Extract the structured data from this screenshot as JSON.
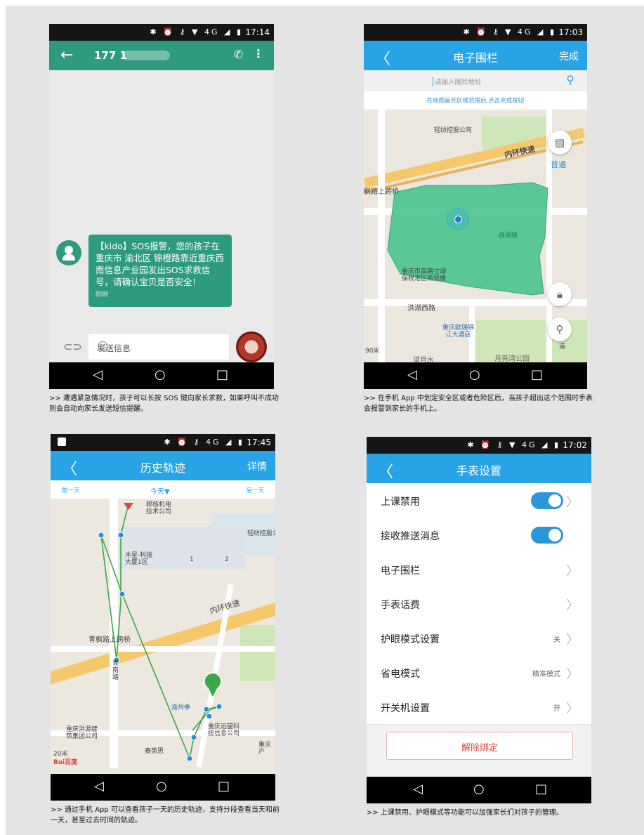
{
  "panel1": {
    "status_time": "17:14",
    "status_icons": "✱ ⏰ ⚷ ▼ 4G ◢ ▮",
    "contact": "177 1",
    "phone_icon": "phone-icon",
    "menu_icon": "more-vert-icon",
    "message": "【kido】SOS报警，您的孩子在 重庆市 渝北区 锦橙路靠近重庆西南信息产业园发出SOS求救信号，请确认宝贝是否安全！",
    "message_time": "刚刚",
    "compose_placeholder": "发送信息",
    "caption": ">> 遭遇紧急情况时，孩子可以长按 SOS 键向家长求救，如果呼叫不成功则会自动向家长发送短信提醒。"
  },
  "panel2": {
    "status_time": "17:03",
    "status_icons": "✱ ⏰ ⚷ ▼ 4G ◢ ▮",
    "title": "电子围栏",
    "done": "完成",
    "search_placeholder": "请输入围栏地址",
    "hint": "在地图画完区域范围后,点击完成按钮",
    "map_labels": [
      "轻纺控股公司",
      "内环快速",
      "普通",
      "枫路上跨桥",
      "西湖路",
      "重庆市高路寸湖\n保税港区商贸楼",
      "洪湖西路",
      "重庆欧瑞锦\n江大酒店",
      "月亮湾公园",
      "望月水",
      "90米",
      "道"
    ],
    "caption": ">> 在手机 App 中划定安全区或者危险区后，当孩子超出这个范围时手表会报警到家长的手机上。"
  },
  "panel3": {
    "status_time": "17:45",
    "status_icons": "✱ ⏰ ⚷ 4G ◢ ▮",
    "title": "历史轨迹",
    "details": "详情",
    "prev_day": "前一天",
    "today": "今天▼",
    "next_day": "后一天",
    "map_labels": [
      "邮核机电\n技术公司",
      "轻纺控股公",
      "木星-科技\n大厦1区",
      "1",
      "2",
      "内环快速",
      "青枫路上跨桥",
      "青\n南\n路",
      "渝州拳",
      "重庆远望科\n技信息公司",
      "重庆洪源建\n筑集团公司",
      "赛英思",
      "重庆\n产",
      "20米",
      "Bai百度"
    ],
    "caption": ">> 通过手机 App 可以查看孩子一天的历史轨迹，支持分段查看当天和前一天，甚至过去时间的轨迹。"
  },
  "panel4": {
    "status_time": "17:02",
    "status_icons": "✱ ⏰ ⚷ ▼ 4G ◢ ▮",
    "title": "手表设置",
    "rows": [
      {
        "label": "上课禁用",
        "value": "",
        "toggle": true,
        "chevron": true
      },
      {
        "label": "接收推送消息",
        "value": "",
        "toggle": true,
        "chevron": false
      },
      {
        "label": "电子围栏",
        "value": "",
        "toggle": false,
        "chevron": true
      },
      {
        "label": "手表话费",
        "value": "",
        "toggle": false,
        "chevron": true
      },
      {
        "label": "护眼模式设置",
        "value": "关",
        "toggle": false,
        "chevron": true
      },
      {
        "label": "省电模式",
        "value": "精准模式",
        "toggle": false,
        "chevron": true
      },
      {
        "label": "开关机设置",
        "value": "开",
        "toggle": false,
        "chevron": true
      }
    ],
    "unbind": "解除绑定",
    "caption": ">> 上课禁用、护眼模式等功能可以加强家长们对孩子的管理。"
  },
  "nav": {
    "back": "◁",
    "home": "○",
    "recents": "□"
  },
  "colors": {
    "sms_green": "#2e9a80",
    "app_blue": "#28a3e6",
    "toggle_blue": "#2b97d8",
    "unbind_red": "#e0473a",
    "fence_green": "#3fc18a",
    "track_green": "#3aa84a"
  }
}
